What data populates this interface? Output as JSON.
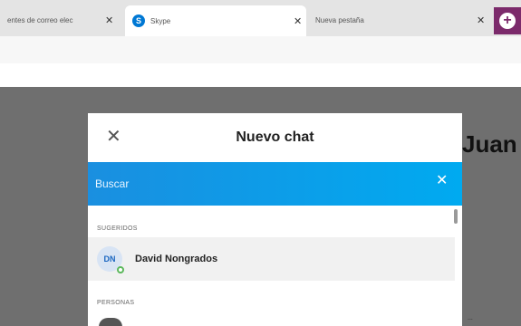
{
  "browser": {
    "tabs": [
      {
        "title": "entes de correo elec",
        "close": "✕"
      },
      {
        "title": "Skype",
        "close": "✕",
        "icon": "skype-logo",
        "icon_glyph": "S"
      },
      {
        "title": "Nueva pestaña",
        "close": "✕"
      }
    ],
    "new_tab_glyph": "+"
  },
  "background": {
    "name_fragment": "Juan",
    "small_text": "..."
  },
  "modal": {
    "close_glyph": "✕",
    "title": "Nuevo chat",
    "search": {
      "placeholder": "Buscar",
      "clear_glyph": "✕"
    },
    "sections": {
      "suggested_label": "SUGERIDOS",
      "people_label": "PERSONAS"
    },
    "suggested": [
      {
        "initials": "DN",
        "name": "David Nongrados",
        "status": "online"
      }
    ]
  },
  "colors": {
    "accent": "#0078d4",
    "search_gradient_start": "#1a8fe0",
    "search_gradient_end": "#00aaf0",
    "presence_online": "#5cb85c"
  }
}
